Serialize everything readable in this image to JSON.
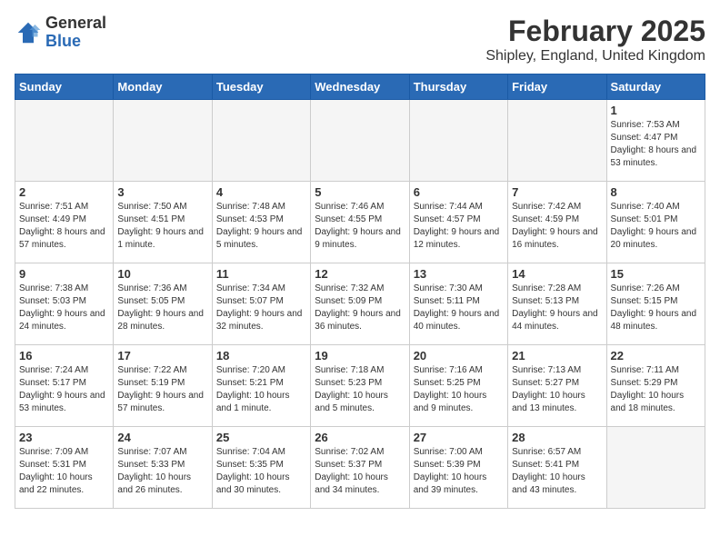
{
  "logo": {
    "general": "General",
    "blue": "Blue"
  },
  "title": "February 2025",
  "subtitle": "Shipley, England, United Kingdom",
  "headers": [
    "Sunday",
    "Monday",
    "Tuesday",
    "Wednesday",
    "Thursday",
    "Friday",
    "Saturday"
  ],
  "weeks": [
    [
      {
        "day": "",
        "info": ""
      },
      {
        "day": "",
        "info": ""
      },
      {
        "day": "",
        "info": ""
      },
      {
        "day": "",
        "info": ""
      },
      {
        "day": "",
        "info": ""
      },
      {
        "day": "",
        "info": ""
      },
      {
        "day": "1",
        "info": "Sunrise: 7:53 AM\nSunset: 4:47 PM\nDaylight: 8 hours and 53 minutes."
      }
    ],
    [
      {
        "day": "2",
        "info": "Sunrise: 7:51 AM\nSunset: 4:49 PM\nDaylight: 8 hours and 57 minutes."
      },
      {
        "day": "3",
        "info": "Sunrise: 7:50 AM\nSunset: 4:51 PM\nDaylight: 9 hours and 1 minute."
      },
      {
        "day": "4",
        "info": "Sunrise: 7:48 AM\nSunset: 4:53 PM\nDaylight: 9 hours and 5 minutes."
      },
      {
        "day": "5",
        "info": "Sunrise: 7:46 AM\nSunset: 4:55 PM\nDaylight: 9 hours and 9 minutes."
      },
      {
        "day": "6",
        "info": "Sunrise: 7:44 AM\nSunset: 4:57 PM\nDaylight: 9 hours and 12 minutes."
      },
      {
        "day": "7",
        "info": "Sunrise: 7:42 AM\nSunset: 4:59 PM\nDaylight: 9 hours and 16 minutes."
      },
      {
        "day": "8",
        "info": "Sunrise: 7:40 AM\nSunset: 5:01 PM\nDaylight: 9 hours and 20 minutes."
      }
    ],
    [
      {
        "day": "9",
        "info": "Sunrise: 7:38 AM\nSunset: 5:03 PM\nDaylight: 9 hours and 24 minutes."
      },
      {
        "day": "10",
        "info": "Sunrise: 7:36 AM\nSunset: 5:05 PM\nDaylight: 9 hours and 28 minutes."
      },
      {
        "day": "11",
        "info": "Sunrise: 7:34 AM\nSunset: 5:07 PM\nDaylight: 9 hours and 32 minutes."
      },
      {
        "day": "12",
        "info": "Sunrise: 7:32 AM\nSunset: 5:09 PM\nDaylight: 9 hours and 36 minutes."
      },
      {
        "day": "13",
        "info": "Sunrise: 7:30 AM\nSunset: 5:11 PM\nDaylight: 9 hours and 40 minutes."
      },
      {
        "day": "14",
        "info": "Sunrise: 7:28 AM\nSunset: 5:13 PM\nDaylight: 9 hours and 44 minutes."
      },
      {
        "day": "15",
        "info": "Sunrise: 7:26 AM\nSunset: 5:15 PM\nDaylight: 9 hours and 48 minutes."
      }
    ],
    [
      {
        "day": "16",
        "info": "Sunrise: 7:24 AM\nSunset: 5:17 PM\nDaylight: 9 hours and 53 minutes."
      },
      {
        "day": "17",
        "info": "Sunrise: 7:22 AM\nSunset: 5:19 PM\nDaylight: 9 hours and 57 minutes."
      },
      {
        "day": "18",
        "info": "Sunrise: 7:20 AM\nSunset: 5:21 PM\nDaylight: 10 hours and 1 minute."
      },
      {
        "day": "19",
        "info": "Sunrise: 7:18 AM\nSunset: 5:23 PM\nDaylight: 10 hours and 5 minutes."
      },
      {
        "day": "20",
        "info": "Sunrise: 7:16 AM\nSunset: 5:25 PM\nDaylight: 10 hours and 9 minutes."
      },
      {
        "day": "21",
        "info": "Sunrise: 7:13 AM\nSunset: 5:27 PM\nDaylight: 10 hours and 13 minutes."
      },
      {
        "day": "22",
        "info": "Sunrise: 7:11 AM\nSunset: 5:29 PM\nDaylight: 10 hours and 18 minutes."
      }
    ],
    [
      {
        "day": "23",
        "info": "Sunrise: 7:09 AM\nSunset: 5:31 PM\nDaylight: 10 hours and 22 minutes."
      },
      {
        "day": "24",
        "info": "Sunrise: 7:07 AM\nSunset: 5:33 PM\nDaylight: 10 hours and 26 minutes."
      },
      {
        "day": "25",
        "info": "Sunrise: 7:04 AM\nSunset: 5:35 PM\nDaylight: 10 hours and 30 minutes."
      },
      {
        "day": "26",
        "info": "Sunrise: 7:02 AM\nSunset: 5:37 PM\nDaylight: 10 hours and 34 minutes."
      },
      {
        "day": "27",
        "info": "Sunrise: 7:00 AM\nSunset: 5:39 PM\nDaylight: 10 hours and 39 minutes."
      },
      {
        "day": "28",
        "info": "Sunrise: 6:57 AM\nSunset: 5:41 PM\nDaylight: 10 hours and 43 minutes."
      },
      {
        "day": "",
        "info": ""
      }
    ]
  ]
}
